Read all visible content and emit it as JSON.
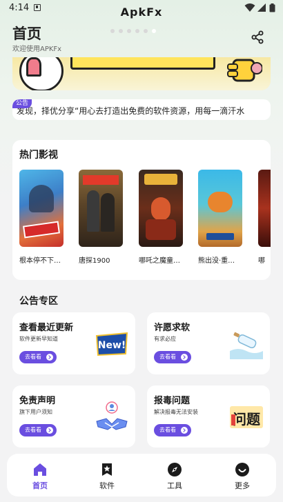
{
  "status_bar": {
    "time": "4:14"
  },
  "header": {
    "title": "首页",
    "subtitle": "欢迎使用APKFx"
  },
  "banner": {
    "text": "ApkFx",
    "slide_count": 6,
    "active_slide": 6
  },
  "notice": {
    "badge": "公告",
    "text": "发现，择优分享“用心去打造出免费的软件资源，用每一滴汗水"
  },
  "hot": {
    "title": "热门影视",
    "movies": [
      {
        "name": "根本停不下…"
      },
      {
        "name": "唐探1900"
      },
      {
        "name": "哪吒之魔童…"
      },
      {
        "name": "熊出没·重…"
      },
      {
        "name": "哪"
      }
    ]
  },
  "announcements": {
    "title": "公告专区",
    "cards": [
      {
        "name": "查看最近更新",
        "desc": "软件更新早知道",
        "button": "去看看"
      },
      {
        "name": "许愿求软",
        "desc": "有求必应",
        "button": "去看看"
      },
      {
        "name": "免责声明",
        "desc": "旗下用户须知",
        "button": "去看看"
      },
      {
        "name": "报毒问题",
        "desc": "解决报毒无法安装",
        "button": "去看看"
      }
    ],
    "illustration_texts": {
      "new_badge": "New!",
      "issue_badge": "问题"
    }
  },
  "bottom_nav": {
    "items": [
      {
        "label": "首页",
        "icon": "home-icon",
        "active": true
      },
      {
        "label": "软件",
        "icon": "star-bookmark-icon",
        "active": false
      },
      {
        "label": "工具",
        "icon": "compass-icon",
        "active": false
      },
      {
        "label": "更多",
        "icon": "smile-icon",
        "active": false
      }
    ]
  },
  "colors": {
    "accent": "#6a4ee0",
    "card_bg": "#ffffff",
    "page_bg": "#f3f3f4"
  }
}
